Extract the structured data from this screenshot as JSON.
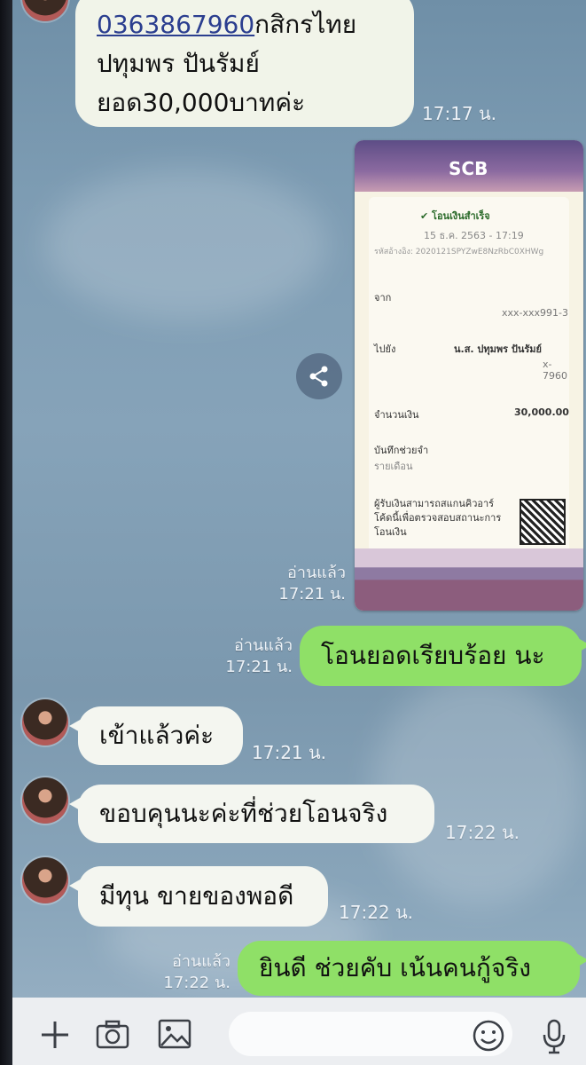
{
  "messages": [
    {
      "id": "m1",
      "dir": "in",
      "lines": [
        "0363867960กสิกรไทย",
        "ปทุมพร  ปันรัมย์",
        "ยอด30,000บาทค่ะ"
      ],
      "link": "0363867960",
      "time": "17:17 น."
    },
    {
      "id": "m2",
      "dir": "out",
      "type": "image",
      "read": "อ่านแล้ว",
      "time": "17:21 น."
    },
    {
      "id": "m3",
      "dir": "out",
      "text": "โอนยอดเรียบร้อย นะ",
      "read": "อ่านแล้ว",
      "time": "17:21 น."
    },
    {
      "id": "m4",
      "dir": "in",
      "text": "เข้าแล้วค่ะ",
      "time": "17:21 น."
    },
    {
      "id": "m5",
      "dir": "in",
      "text": "ขอบคุนนะค่ะที่ช่วยโอนจริง",
      "time": "17:22 น."
    },
    {
      "id": "m6",
      "dir": "in",
      "text": "มีทุน  ขายของพอดี",
      "time": "17:22 น."
    },
    {
      "id": "m7",
      "dir": "out",
      "text": "ยินดี  ช่วยคับ  เน้นคนกู้จริง",
      "read": "อ่านแล้ว",
      "time": "17:22 น."
    }
  ],
  "receipt": {
    "bank": "SCB",
    "status": "โอนเงินสำเร็จ",
    "date": "15 ธ.ค. 2563 - 17:19",
    "ref": "รหัสอ้างอิง: 2020121SPYZwE8NzRbC0XHWg",
    "from_label": "จาก",
    "from_acct": "xxx-xxx991-3",
    "to_label": "ไปยัง",
    "to_name": "น.ส. ปทุมพร ปันรัมย์",
    "to_acct": "x-7960",
    "amount_label": "จำนวนเงิน",
    "amount": "30,000.00",
    "memo_label": "บันทึกช่วยจำ",
    "memo": "รายเดือน",
    "note": "ผู้รับเงินสามารถสแกนคิวอาร์โค้ดนี้เพื่อตรวจสอบสถานะการโอนเงิน"
  },
  "icons": {
    "share": "share-icon",
    "plus": "plus-icon",
    "camera": "camera-icon",
    "image": "image-icon",
    "emoji": "emoji-icon",
    "mic": "mic-icon"
  },
  "colors": {
    "incoming": "#f4f6f0",
    "outgoing": "#8fe067",
    "link": "#2b3e8f"
  }
}
